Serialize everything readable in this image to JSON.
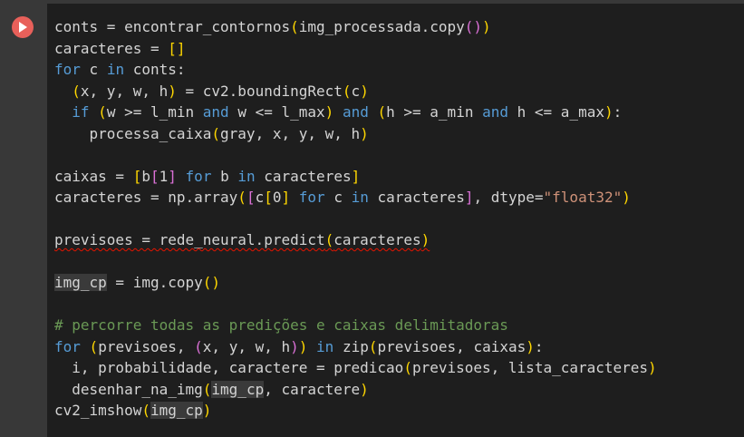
{
  "cell": {
    "run_icon": "play-icon",
    "colors": {
      "run_button": "#e8605a",
      "editor_bg": "#1e1e1e",
      "keyword": "#569cd6",
      "string": "#ce9178",
      "comment": "#6a9955",
      "bracket_level1": "#ffd700",
      "bracket_level2": "#da70d6",
      "error_underline": "#e51400"
    },
    "code_lines": [
      [
        {
          "t": "conts = encontrar_contornos"
        },
        {
          "t": "(",
          "c": "b1"
        },
        {
          "t": "img_processada.copy"
        },
        {
          "t": "()",
          "c": "b2"
        },
        {
          "t": ")",
          "c": "b1"
        }
      ],
      [
        {
          "t": "caracteres = "
        },
        {
          "t": "[]",
          "c": "b1"
        }
      ],
      [
        {
          "t": "for",
          "c": "kw"
        },
        {
          "t": " c "
        },
        {
          "t": "in",
          "c": "kw"
        },
        {
          "t": " conts:"
        }
      ],
      [
        {
          "t": "  "
        },
        {
          "t": "(",
          "c": "b1"
        },
        {
          "t": "x, y, w, h"
        },
        {
          "t": ")",
          "c": "b1"
        },
        {
          "t": " = cv2.boundingRect"
        },
        {
          "t": "(",
          "c": "b1"
        },
        {
          "t": "c"
        },
        {
          "t": ")",
          "c": "b1"
        }
      ],
      [
        {
          "t": "  "
        },
        {
          "t": "if",
          "c": "kw"
        },
        {
          "t": " "
        },
        {
          "t": "(",
          "c": "b1"
        },
        {
          "t": "w >= l_min "
        },
        {
          "t": "and",
          "c": "kw"
        },
        {
          "t": " w <= l_max"
        },
        {
          "t": ")",
          "c": "b1"
        },
        {
          "t": " "
        },
        {
          "t": "and",
          "c": "kw"
        },
        {
          "t": " "
        },
        {
          "t": "(",
          "c": "b1"
        },
        {
          "t": "h >= a_min "
        },
        {
          "t": "and",
          "c": "kw"
        },
        {
          "t": " h <= a_max"
        },
        {
          "t": ")",
          "c": "b1"
        },
        {
          "t": ":"
        }
      ],
      [
        {
          "t": "    processa_caixa"
        },
        {
          "t": "(",
          "c": "b1"
        },
        {
          "t": "gray, x, y, w, h"
        },
        {
          "t": ")",
          "c": "b1"
        }
      ],
      [],
      [
        {
          "t": "caixas = "
        },
        {
          "t": "[",
          "c": "b1"
        },
        {
          "t": "b"
        },
        {
          "t": "[",
          "c": "b2"
        },
        {
          "t": "1"
        },
        {
          "t": "]",
          "c": "b2"
        },
        {
          "t": " "
        },
        {
          "t": "for",
          "c": "kw"
        },
        {
          "t": " b "
        },
        {
          "t": "in",
          "c": "kw"
        },
        {
          "t": " caracteres"
        },
        {
          "t": "]",
          "c": "b1"
        }
      ],
      [
        {
          "t": "caracteres = np.array"
        },
        {
          "t": "(",
          "c": "b1"
        },
        {
          "t": "[",
          "c": "b2"
        },
        {
          "t": "c"
        },
        {
          "t": "[",
          "c": "b1"
        },
        {
          "t": "0"
        },
        {
          "t": "]",
          "c": "b1"
        },
        {
          "t": " "
        },
        {
          "t": "for",
          "c": "kw"
        },
        {
          "t": " c "
        },
        {
          "t": "in",
          "c": "kw"
        },
        {
          "t": " caracteres"
        },
        {
          "t": "]",
          "c": "b2"
        },
        {
          "t": ", dtype="
        },
        {
          "t": "\"float32\"",
          "c": "str"
        },
        {
          "t": ")",
          "c": "b1"
        }
      ],
      [],
      [
        {
          "t": "previsoes = rede_neural.predict",
          "c": "sq"
        },
        {
          "t": "(",
          "c": "b1 sq"
        },
        {
          "t": "caracteres",
          "c": "sq"
        },
        {
          "t": ")",
          "c": "b1 sq"
        }
      ],
      [],
      [
        {
          "t": "img_cp",
          "c": "hl"
        },
        {
          "t": " = img.copy"
        },
        {
          "t": "()",
          "c": "b1"
        }
      ],
      [],
      [
        {
          "t": "# percorre todas as predições e caixas delimitadoras",
          "c": "cmt"
        }
      ],
      [
        {
          "t": "for",
          "c": "kw"
        },
        {
          "t": " "
        },
        {
          "t": "(",
          "c": "b1"
        },
        {
          "t": "previsoes, "
        },
        {
          "t": "(",
          "c": "b2"
        },
        {
          "t": "x, y, w, h"
        },
        {
          "t": ")",
          "c": "b2"
        },
        {
          "t": ")",
          "c": "b1"
        },
        {
          "t": " "
        },
        {
          "t": "in",
          "c": "kw"
        },
        {
          "t": " zip"
        },
        {
          "t": "(",
          "c": "b1"
        },
        {
          "t": "previsoes, caixas"
        },
        {
          "t": ")",
          "c": "b1"
        },
        {
          "t": ":"
        }
      ],
      [
        {
          "t": "  i, probabilidade, caractere = predicao"
        },
        {
          "t": "(",
          "c": "b1"
        },
        {
          "t": "previsoes, lista_caracteres"
        },
        {
          "t": ")",
          "c": "b1"
        }
      ],
      [
        {
          "t": "  desenhar_na_img"
        },
        {
          "t": "(",
          "c": "b1"
        },
        {
          "t": "img_cp",
          "c": "hl"
        },
        {
          "t": ", caractere"
        },
        {
          "t": ")",
          "c": "b1"
        }
      ],
      [
        {
          "t": "cv2_imshow"
        },
        {
          "t": "(",
          "c": "b1"
        },
        {
          "t": "img_cp",
          "c": "hl"
        },
        {
          "t": ")",
          "c": "b1"
        }
      ]
    ]
  }
}
